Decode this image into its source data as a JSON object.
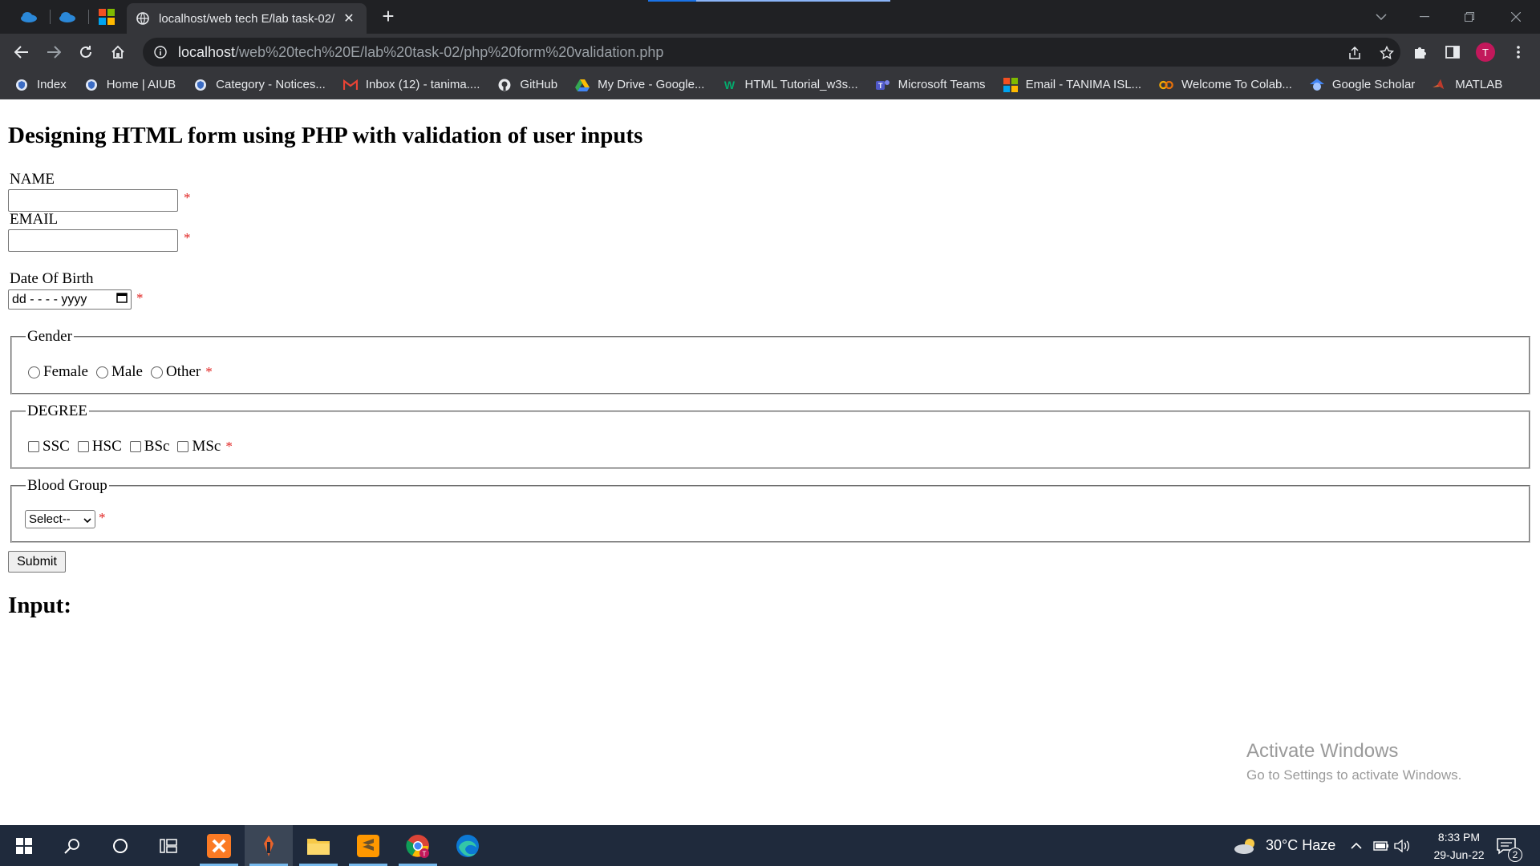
{
  "browser": {
    "active_tab_title": "localhost/web tech E/lab task-02/",
    "tab_close": "✕",
    "new_tab": "+",
    "url_host": "localhost",
    "url_path": "/web%20tech%20E/lab%20task-02/php%20form%20validation.php",
    "profile_initial": "T",
    "bookmarks": [
      {
        "label": "Index",
        "icon": "aiub-icon"
      },
      {
        "label": "Home | AIUB",
        "icon": "aiub-icon"
      },
      {
        "label": "Category - Notices...",
        "icon": "aiub-icon"
      },
      {
        "label": "Inbox (12) - tanima....",
        "icon": "gmail-icon"
      },
      {
        "label": "GitHub",
        "icon": "github-icon"
      },
      {
        "label": "My Drive - Google...",
        "icon": "drive-icon"
      },
      {
        "label": "HTML Tutorial_w3s...",
        "icon": "w3schools-icon"
      },
      {
        "label": "Microsoft Teams",
        "icon": "teams-icon"
      },
      {
        "label": "Email - TANIMA ISL...",
        "icon": "microsoft-icon"
      },
      {
        "label": "Welcome To Colab...",
        "icon": "colab-icon"
      },
      {
        "label": "Google Scholar",
        "icon": "scholar-icon"
      },
      {
        "label": "MATLAB",
        "icon": "matlab-icon"
      }
    ]
  },
  "page": {
    "title": "Designing HTML form using PHP with validation of user inputs",
    "name_label": "NAME",
    "email_label": "EMAIL",
    "dob_label": "Date Of Birth",
    "dob_placeholder": "dd - - - - yyyy",
    "required_mark": "*",
    "gender_legend": "Gender",
    "gender_options": [
      "Female",
      "Male",
      "Other"
    ],
    "degree_legend": "DEGREE",
    "degree_options": [
      "SSC",
      "HSC",
      "BSc",
      "MSc"
    ],
    "blood_legend": "Blood Group",
    "blood_selected": "Select--",
    "submit_label": "Submit",
    "input_heading": "Input:",
    "watermark_title": "Activate Windows",
    "watermark_sub": "Go to Settings to activate Windows."
  },
  "taskbar": {
    "weather": "30°C  Haze",
    "time": "8:33 PM",
    "date": "29-Jun-22",
    "notification_count": "2"
  },
  "colors": {
    "required": "#e0201e",
    "browser_dark": "#202124",
    "taskbar": "#1f2a3c"
  }
}
